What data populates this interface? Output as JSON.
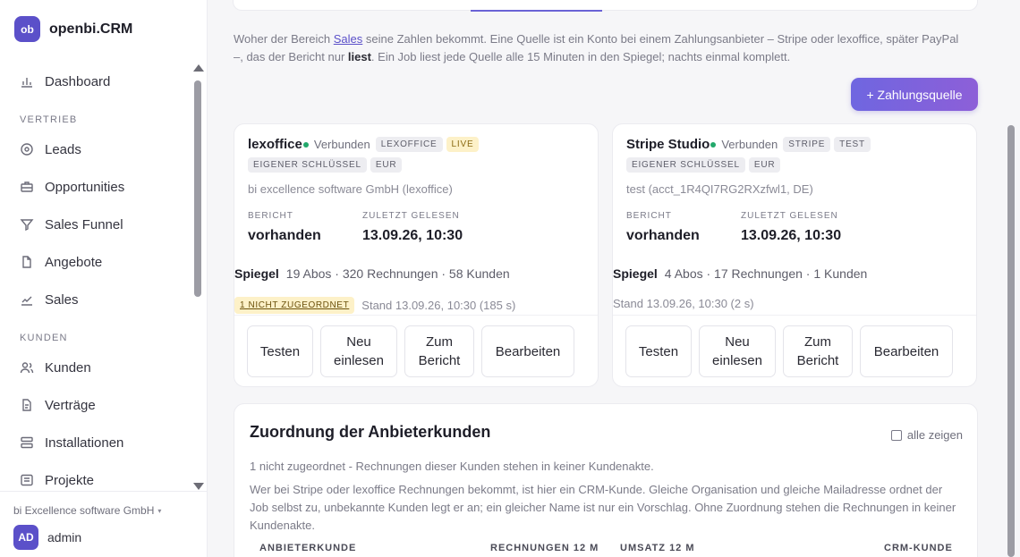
{
  "app": {
    "logo": "ob",
    "name": "openbi.CRM"
  },
  "sidebar": {
    "items": [
      {
        "label": "Dashboard",
        "icon": "bar-chart-icon"
      },
      {
        "section": "VERTRIEB"
      },
      {
        "label": "Leads",
        "icon": "target-icon"
      },
      {
        "label": "Opportunities",
        "icon": "briefcase-icon"
      },
      {
        "label": "Sales Funnel",
        "icon": "funnel-icon"
      },
      {
        "label": "Angebote",
        "icon": "document-icon"
      },
      {
        "label": "Sales",
        "icon": "trend-chart-icon"
      },
      {
        "section": "KUNDEN"
      },
      {
        "label": "Kunden",
        "icon": "users-icon"
      },
      {
        "label": "Verträge",
        "icon": "contract-icon"
      },
      {
        "label": "Installationen",
        "icon": "server-icon"
      },
      {
        "label": "Projekte",
        "icon": "list-icon"
      }
    ],
    "org": "bi Excellence software GmbH",
    "user": {
      "initials": "AD",
      "name": "admin"
    }
  },
  "intro": {
    "p1": "Woher der Bereich ",
    "link": "Sales",
    "p2": " seine Zahlen bekommt. Eine Quelle ist ein Konto bei einem Zahlungsanbieter – Stripe oder lexoffice, später PayPal –, das der Bericht nur ",
    "bold": "liest",
    "p3": ". Ein Job liest jede Quelle alle 15 Minuten in den Spiegel; nachts einmal komplett."
  },
  "add_button": "+ Zahlungsquelle",
  "cards": [
    {
      "title": "lexoffice",
      "status": "Verbunden",
      "tags": [
        "LEXOFFICE",
        "LIVE",
        "EIGENER SCHLÜSSEL",
        "EUR"
      ],
      "subtitle": "bi excellence software GmbH (lexoffice)",
      "report_label": "BERICHT",
      "report_value": "vorhanden",
      "last_read_label": "ZULETZT GELESEN",
      "last_read_value": "13.09.26, 10:30",
      "mirror_label": "Spiegel",
      "mirror_stats": "19 Abos · 320 Rechnungen · 58 Kunden",
      "warning": "1 NICHT ZUGEORDNET",
      "stand": "Stand 13.09.26, 10:30 (185 s)",
      "actions": [
        "Testen",
        "Neu einlesen",
        "Zum Bericht",
        "Bearbeiten"
      ]
    },
    {
      "title": "Stripe Studio",
      "status": "Verbunden",
      "tags": [
        "STRIPE",
        "TEST",
        "EIGENER SCHLÜSSEL",
        "EUR"
      ],
      "subtitle": "test (acct_1R4QI7RG2RXzfwl1, DE)",
      "report_label": "BERICHT",
      "report_value": "vorhanden",
      "last_read_label": "ZULETZT GELESEN",
      "last_read_value": "13.09.26, 10:30",
      "mirror_label": "Spiegel",
      "mirror_stats": "4 Abos · 17 Rechnungen · 1 Kunden",
      "stand": "Stand 13.09.26, 10:30 (2 s)",
      "actions": [
        "Testen",
        "Neu einlesen",
        "Zum Bericht",
        "Bearbeiten"
      ]
    }
  ],
  "mapping": {
    "title": "Zuordnung der Anbieterkunden",
    "show_all": "alle zeigen",
    "summary": "1 nicht zugeordnet - Rechnungen dieser Kunden stehen in keiner Kundenakte.",
    "description": "Wer bei Stripe oder lexoffice Rechnungen bekommt, ist hier ein CRM-Kunde. Gleiche Organisation und gleiche Mailadresse ordnet der Job selbst zu, unbekannte Kunden legt er an; ein gleicher Name ist nur ein Vorschlag. Ohne Zuordnung stehen die Rechnungen in keiner Kundenakte.",
    "columns": [
      "ANBIETERKUNDE",
      "RECHNUNGEN 12 M",
      "UMSATZ 12 M",
      "CRM-KUNDE"
    ]
  }
}
